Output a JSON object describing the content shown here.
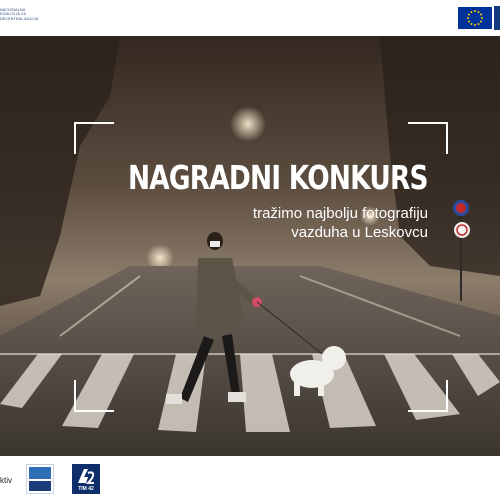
{
  "header": {
    "org_logo_lines": [
      "NACIONALNA",
      "KOALICIJA ZA",
      "DECENTRALIZACIJU"
    ],
    "eu_flag_icon": "eu-flag-icon"
  },
  "hero": {
    "title": "NAGRADNI KONKURS",
    "subtitle_lines": [
      "tražimo najbolju fotografiju",
      "vazduha u Leskovcu"
    ]
  },
  "footer": {
    "partner_text_logo": "ktiv",
    "partner_2_label": "TIM 42"
  },
  "colors": {
    "eu_blue": "#003399",
    "eu_star": "#ffcc00",
    "partner_blue": "#0e2f6b",
    "fog": "#8a7a68"
  }
}
